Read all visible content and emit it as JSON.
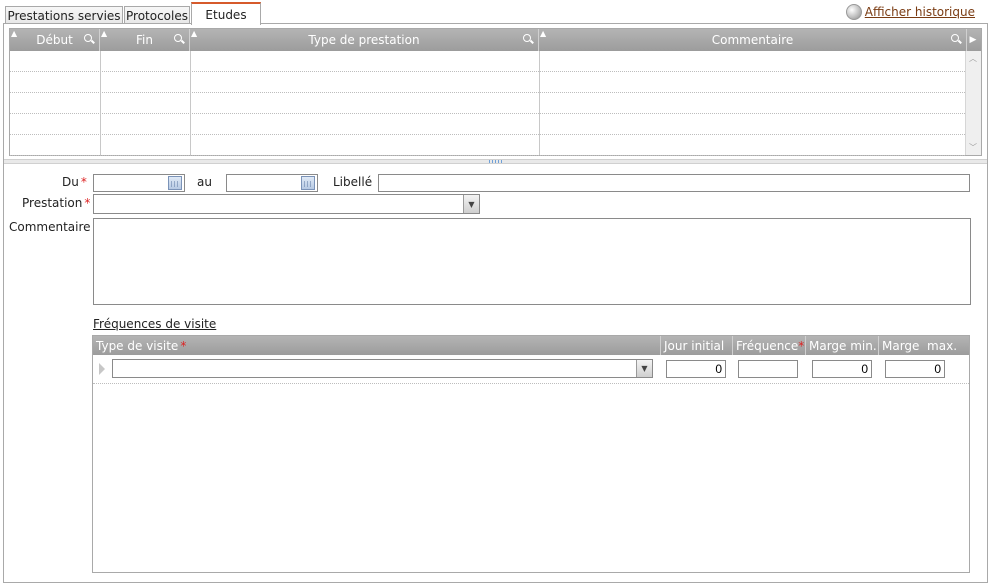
{
  "tabs": [
    {
      "label": "Prestations servies"
    },
    {
      "label": "Protocoles"
    },
    {
      "label": "Etudes"
    }
  ],
  "history_link": "Afficher historique",
  "grid": {
    "columns": [
      "Début",
      "Fin",
      "Type de prestation",
      "Commentaire"
    ]
  },
  "form": {
    "du_label": "Du",
    "au_label": "au",
    "libelle_label": "Libellé",
    "prestation_label": "Prestation",
    "commentaire_label": "Commentaire",
    "required_mark": "*",
    "du_value": "",
    "au_value": "",
    "libelle_value": "",
    "prestation_value": "",
    "commentaire_value": ""
  },
  "visits": {
    "title": "Fréquences de visite",
    "columns": {
      "type": "Type de visite",
      "jour_initial": "Jour initial",
      "frequence": "Fréquence",
      "marge_min": "Marge min.",
      "marge_max": "Marge  max."
    },
    "row": {
      "type_value": "",
      "jour_initial": "0",
      "frequence": "",
      "marge_min": "0",
      "marge_max": "0"
    }
  },
  "colors": {
    "active_tab_accent": "#d65a2b",
    "header_gray": "#a8a8a8",
    "required": "#dd2222"
  }
}
